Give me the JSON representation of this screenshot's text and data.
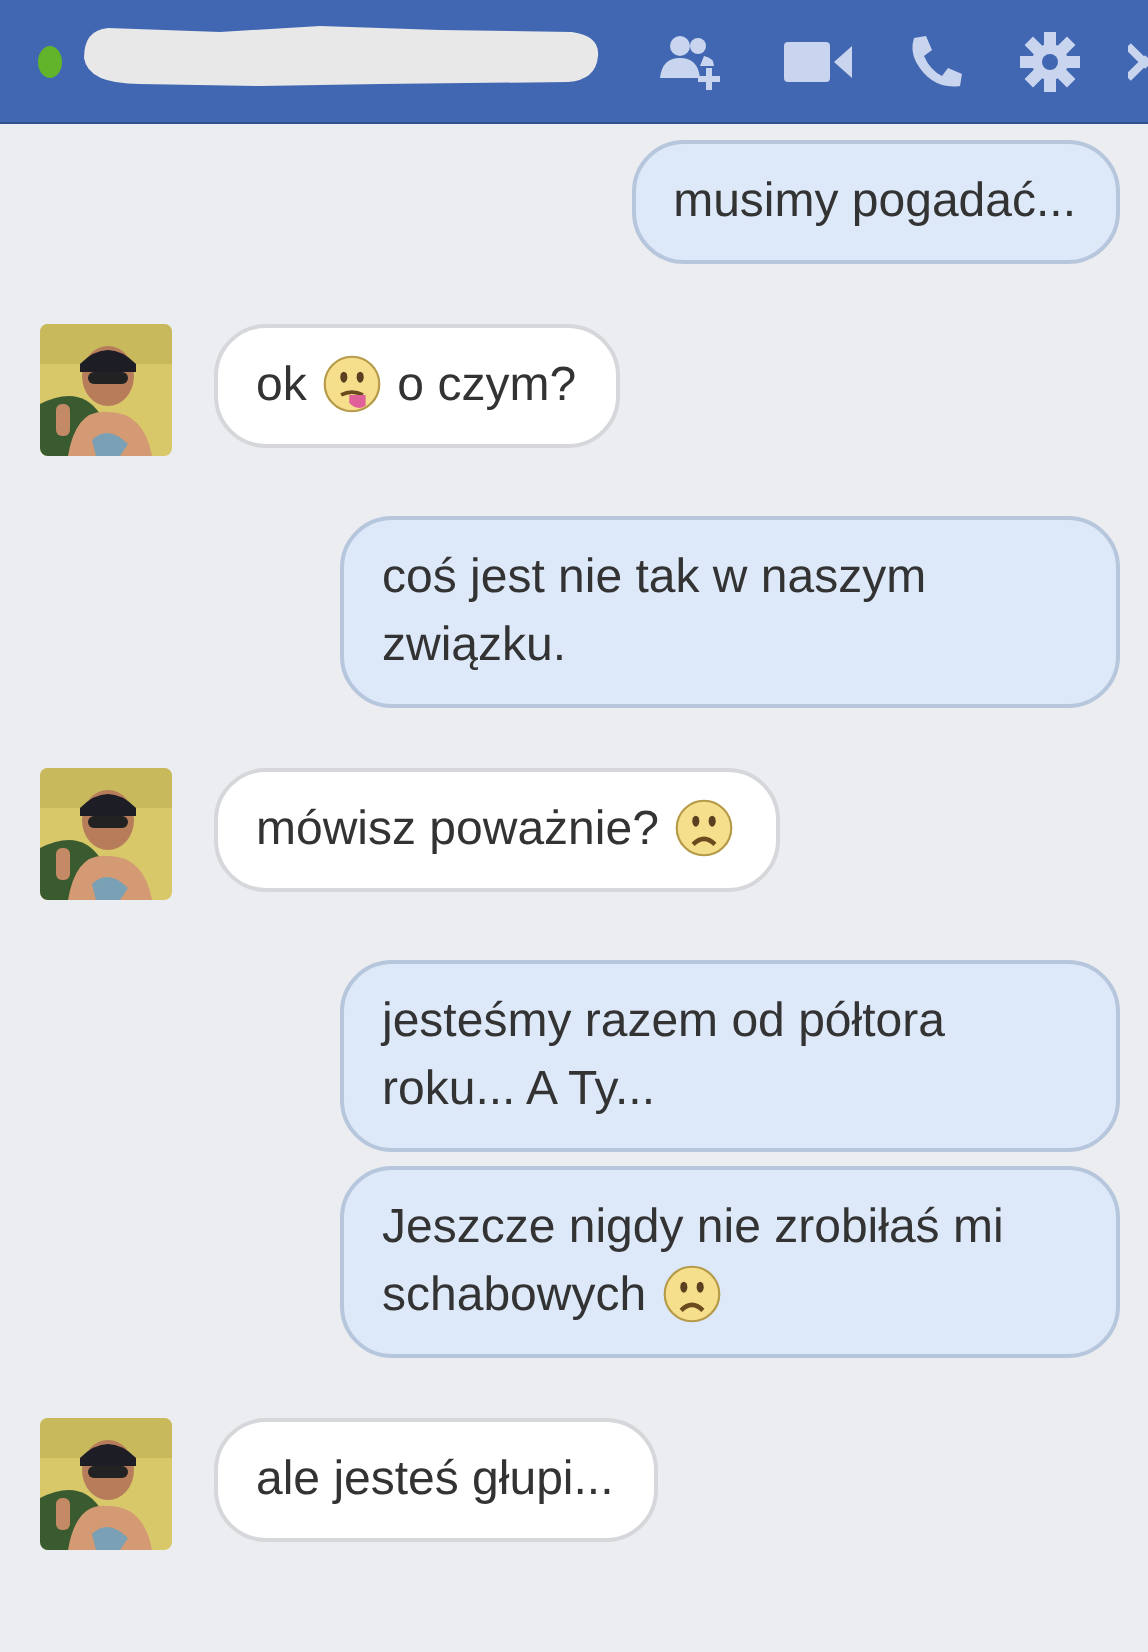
{
  "header": {
    "online": true,
    "name_redacted": true
  },
  "messages": [
    {
      "outgoing": true,
      "parts": [
        {
          "kind": "text",
          "text": "musimy pogadać..."
        }
      ]
    },
    {
      "outgoing": false,
      "parts": [
        {
          "kind": "text",
          "text": "ok"
        },
        {
          "kind": "tongue"
        },
        {
          "kind": "text",
          "text": "o czym?"
        }
      ]
    },
    {
      "outgoing": true,
      "parts": [
        {
          "kind": "text",
          "text": "coś jest nie tak w naszym związku."
        }
      ]
    },
    {
      "outgoing": false,
      "parts": [
        {
          "kind": "text",
          "text": "mówisz poważnie?"
        },
        {
          "kind": "frown"
        }
      ]
    },
    {
      "outgoing": true,
      "parts": [
        {
          "kind": "text",
          "text": "jesteśmy razem od półtora roku... A Ty..."
        }
      ]
    },
    {
      "outgoing": true,
      "parts": [
        {
          "kind": "text",
          "text": "Jeszcze nigdy nie zrobiłaś mi schabowych"
        },
        {
          "kind": "frown"
        }
      ]
    },
    {
      "outgoing": false,
      "parts": [
        {
          "kind": "text",
          "text": "ale jesteś głupi..."
        }
      ]
    }
  ]
}
